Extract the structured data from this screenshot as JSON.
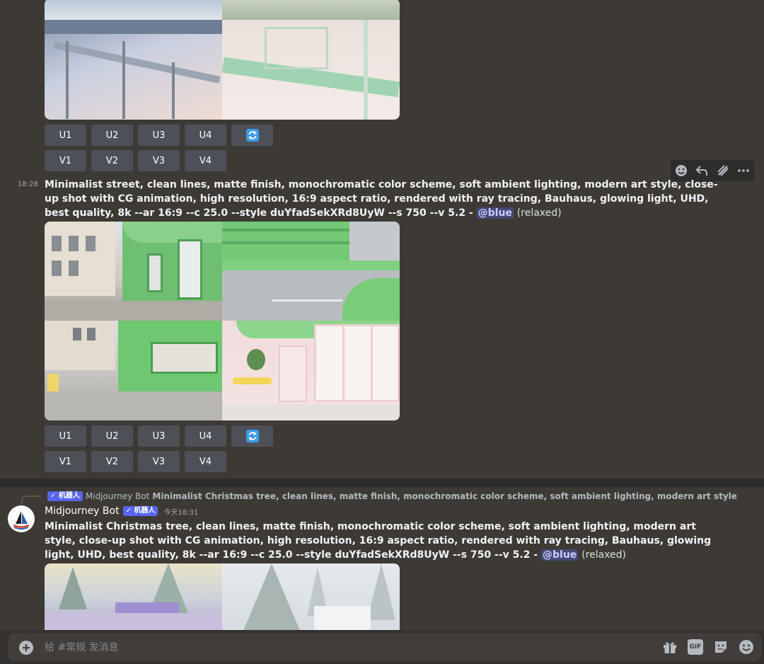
{
  "colors": {
    "background": "#3d3a36",
    "button": "#4e5058",
    "mention_bg": "#5865f2",
    "reroll_icon": "#3b9be8"
  },
  "message1": {
    "buttons_row_u": [
      "U1",
      "U2",
      "U3",
      "U4"
    ],
    "buttons_row_v": [
      "V1",
      "V2",
      "V3",
      "V4"
    ],
    "reroll_icon": "refresh-icon"
  },
  "message2": {
    "timestamp": "18:28",
    "prompt": "Minimalist street, clean lines, matte finish, monochromatic color scheme, soft ambient lighting, modern art style, close-up shot with CG animation, high resolution, 16:9 aspect ratio, rendered with ray tracing, Bauhaus, glowing light, UHD, best quality, 8k --ar 16:9 --c 25.0 --style duYfadSekXRd8UyW --s 750 --v 5.2 - ",
    "mention": "@blue",
    "status": "(relaxed)",
    "buttons_row_u": [
      "U1",
      "U2",
      "U3",
      "U4"
    ],
    "buttons_row_v": [
      "V1",
      "V2",
      "V3",
      "V4"
    ],
    "reroll_icon": "refresh-icon"
  },
  "hover_actions": [
    "add-reaction-icon",
    "reply-icon",
    "create-thread-icon",
    "more-icon"
  ],
  "message3": {
    "reply_badge": "✓ 机器人",
    "reply_author": "Midjourney Bot",
    "reply_text": "Minimalist Christmas tree, clean lines, matte finish, monochromatic color scheme, soft ambient lighting, modern art style, close-up shot with",
    "author": "Midjourney Bot",
    "badge": "✓ 机器人",
    "timestamp": "今天18:31",
    "prompt": "Minimalist Christmas tree, clean lines, matte finish, monochromatic color scheme, soft ambient lighting, modern art style, close-up shot with CG animation, high resolution, 16:9 aspect ratio, rendered with ray tracing, Bauhaus, glowing light, UHD, best quality, 8k --ar 16:9 --c 25.0 --style duYfadSekXRd8UyW --s 750 --v 5.2 - ",
    "mention": "@blue",
    "status": "(relaxed)"
  },
  "composer": {
    "placeholder": "给 #常规 发消息",
    "gif_label": "GIF"
  }
}
